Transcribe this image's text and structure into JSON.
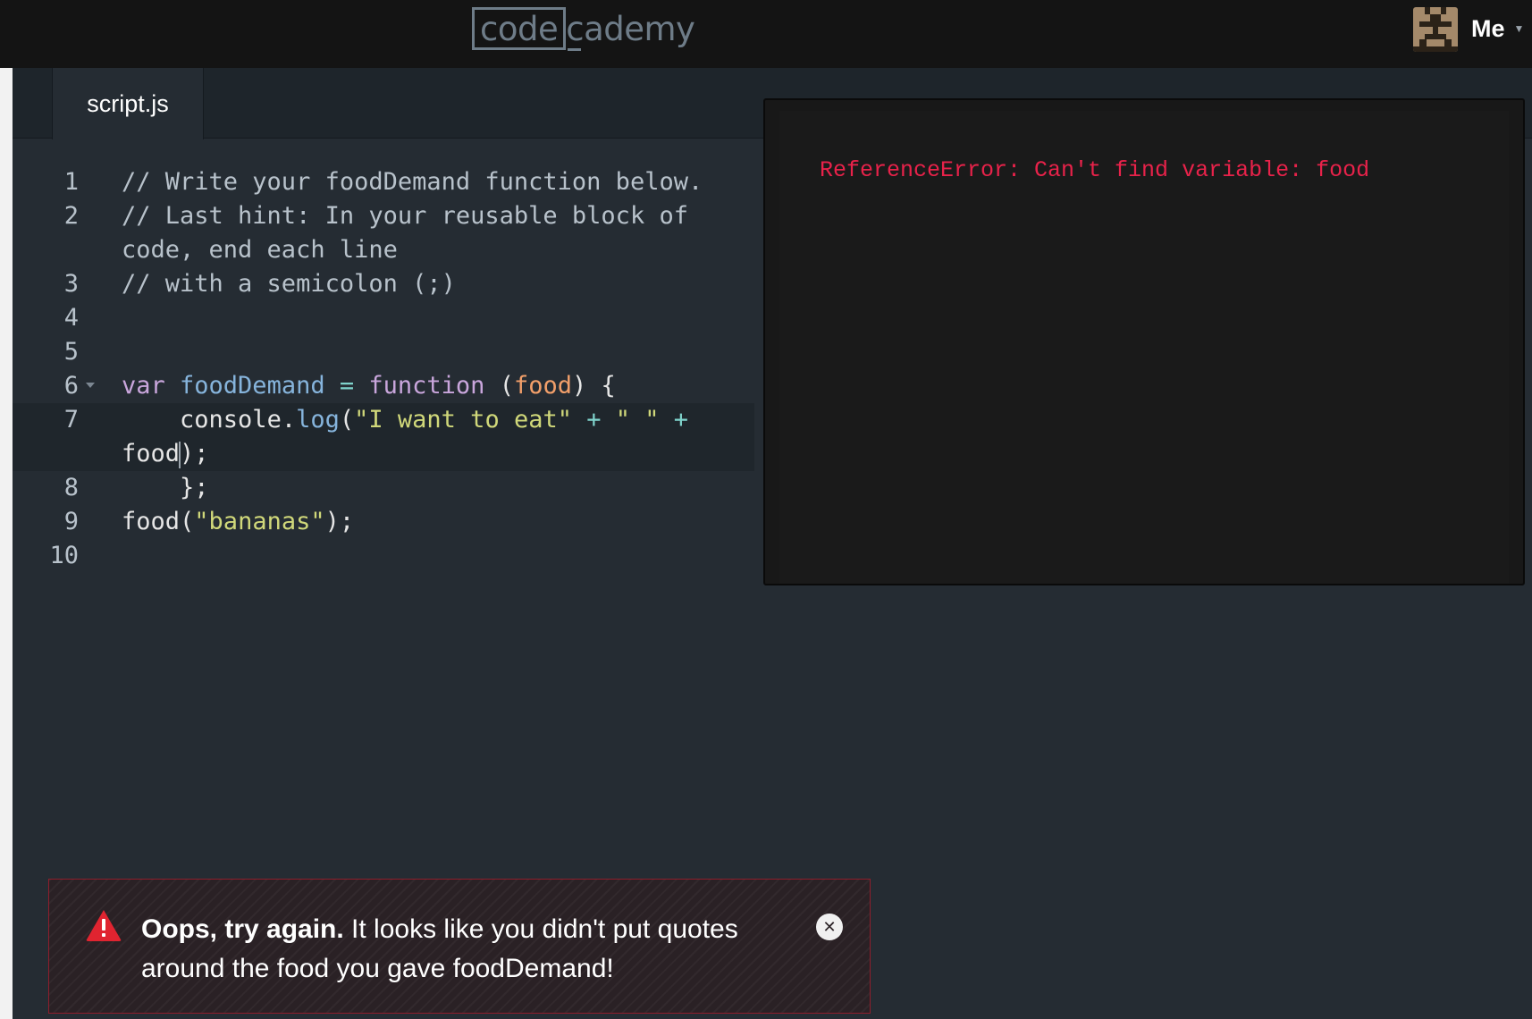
{
  "nav": {
    "logo_boxed": "code",
    "logo_rest": "cademy",
    "user_label": "Me",
    "avatar_icon": "pixel-avatar-icon",
    "caret_icon": "chevron-down-icon"
  },
  "editor": {
    "tab_label": "script.js",
    "lines": [
      {
        "num": "1",
        "segments": [
          {
            "cls": "cm-comment",
            "text": "// Write your foodDemand function below."
          }
        ]
      },
      {
        "num": "2",
        "segments": [
          {
            "cls": "cm-comment",
            "text": "// Last hint: In your reusable block of code, end each line"
          }
        ]
      },
      {
        "num": "3",
        "segments": [
          {
            "cls": "cm-comment",
            "text": "// with a semicolon (;)"
          }
        ]
      },
      {
        "num": "4",
        "segments": []
      },
      {
        "num": "5",
        "segments": []
      },
      {
        "num": "6",
        "fold": true,
        "segments": [
          {
            "cls": "cm-keyword",
            "text": "var "
          },
          {
            "cls": "cm-def",
            "text": "foodDemand"
          },
          {
            "cls": "cm-op",
            "text": " = "
          },
          {
            "cls": "cm-keyword",
            "text": "function "
          },
          {
            "cls": "cm-punct",
            "text": "("
          },
          {
            "cls": "cm-param",
            "text": "food"
          },
          {
            "cls": "cm-punct",
            "text": ") {"
          }
        ]
      },
      {
        "num": "7",
        "active": true,
        "segments": [
          {
            "cls": "cm-var",
            "text": "    console"
          },
          {
            "cls": "cm-punct",
            "text": "."
          },
          {
            "cls": "cm-prop",
            "text": "log"
          },
          {
            "cls": "cm-punct",
            "text": "("
          },
          {
            "cls": "cm-string",
            "text": "\"I want to eat\""
          },
          {
            "cls": "cm-op",
            "text": " + "
          },
          {
            "cls": "cm-string",
            "text": "\" \""
          },
          {
            "cls": "cm-op",
            "text": " + "
          },
          {
            "cls": "cm-var",
            "text": "food"
          },
          {
            "cls": "cursor",
            "text": ""
          },
          {
            "cls": "cm-punct",
            "text": ");"
          }
        ]
      },
      {
        "num": "8",
        "segments": [
          {
            "cls": "cm-punct",
            "text": "    };"
          }
        ]
      },
      {
        "num": "9",
        "segments": [
          {
            "cls": "cm-var",
            "text": "food"
          },
          {
            "cls": "cm-punct",
            "text": "("
          },
          {
            "cls": "cm-string",
            "text": "\"bananas\""
          },
          {
            "cls": "cm-punct",
            "text": ");"
          }
        ]
      },
      {
        "num": "10",
        "segments": []
      }
    ]
  },
  "output": {
    "error_text": "ReferenceError: Can't find variable: food"
  },
  "banner": {
    "title": "Oops, try again.",
    "message": " It looks like you didn't put quotes around the food you gave foodDemand!",
    "warning_icon": "warning-triangle-icon",
    "close_icon": "close-icon"
  },
  "colors": {
    "error_red": "#e8224a",
    "banner_border": "#8e1e2c",
    "editor_bg": "#252c33",
    "topbar_bg": "#141414"
  }
}
